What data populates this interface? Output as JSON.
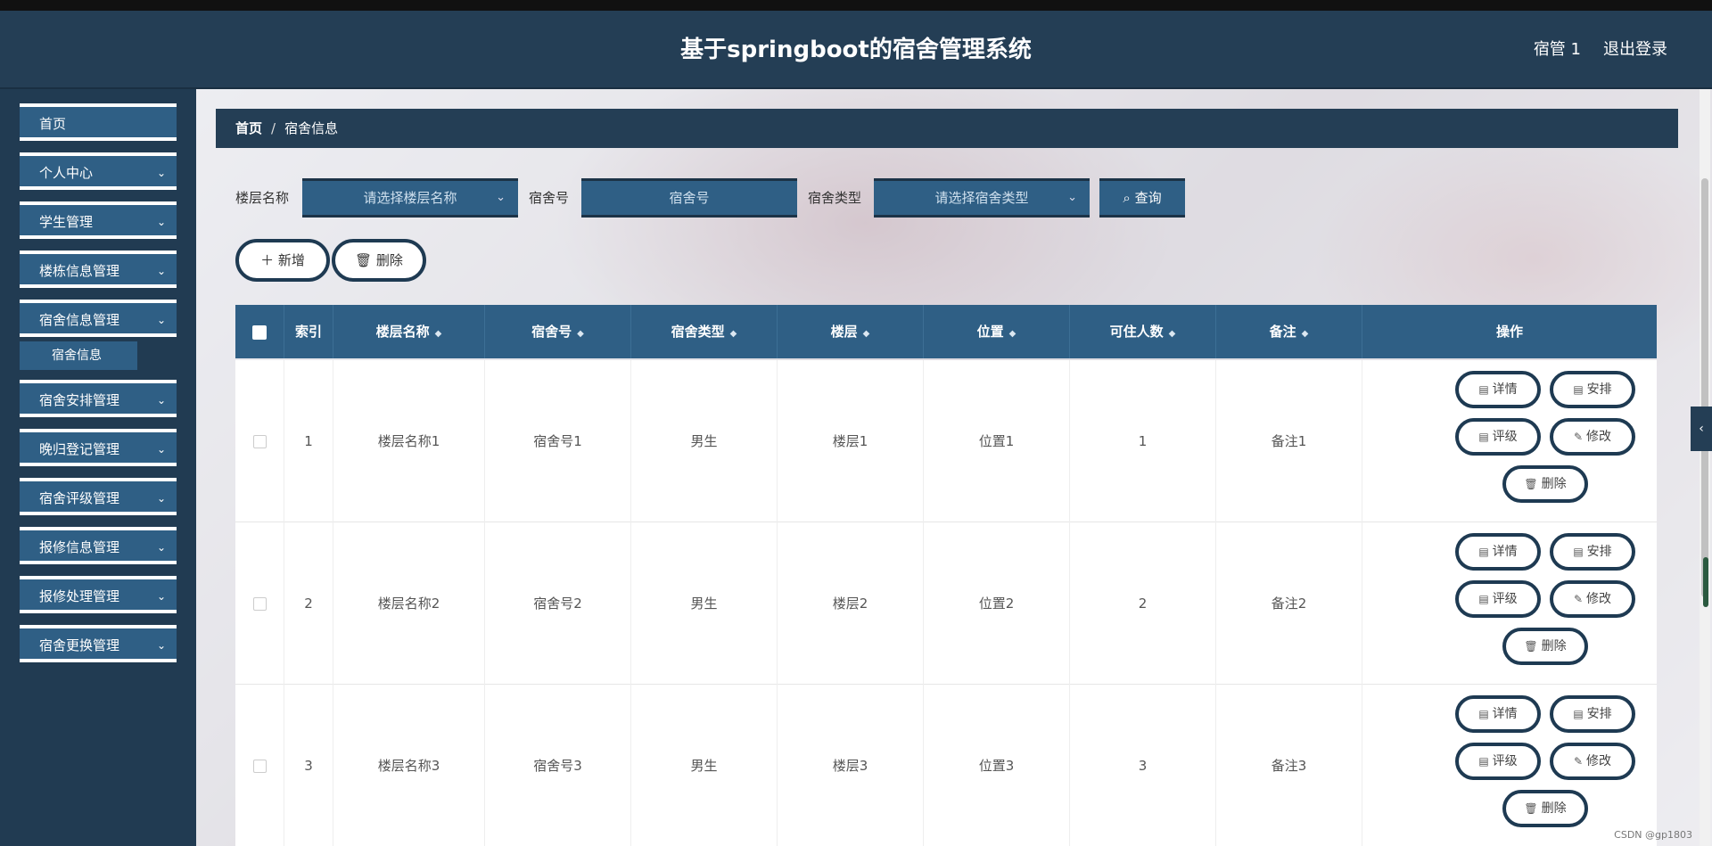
{
  "header": {
    "title": "基于springboot的宿舍管理系统",
    "user": "宿管 1",
    "logout": "退出登录"
  },
  "sidebar": {
    "items": [
      {
        "label": "首页",
        "chevron": ""
      },
      {
        "label": "个人中心",
        "chevron": "⌄"
      },
      {
        "label": "学生管理",
        "chevron": "⌄"
      },
      {
        "label": "楼栋信息管理",
        "chevron": "⌄"
      },
      {
        "label": "宿舍信息管理",
        "chevron": "⌄"
      },
      {
        "label": "宿舍安排管理",
        "chevron": "⌄"
      },
      {
        "label": "晚归登记管理",
        "chevron": "⌄"
      },
      {
        "label": "宿舍评级管理",
        "chevron": "⌄"
      },
      {
        "label": "报修信息管理",
        "chevron": "⌄"
      },
      {
        "label": "报修处理管理",
        "chevron": "⌄"
      },
      {
        "label": "宿舍更换管理",
        "chevron": "⌄"
      }
    ],
    "sub_item": "宿舍信息"
  },
  "breadcrumb": {
    "home": "首页",
    "sep": "/",
    "current": "宿舍信息"
  },
  "filters": {
    "floor_label": "楼层名称",
    "floor_placeholder": "请选择楼层名称",
    "room_label": "宿舍号",
    "room_placeholder": "宿舍号",
    "type_label": "宿舍类型",
    "type_placeholder": "请选择宿舍类型",
    "query": "查询"
  },
  "actions": {
    "add": "新增",
    "delete": "删除"
  },
  "table": {
    "headers": [
      "索引",
      "楼层名称",
      "宿舍号",
      "宿舍类型",
      "楼层",
      "位置",
      "可住人数",
      "备注",
      "操作"
    ],
    "rows": [
      {
        "index": "1",
        "floor_name": "楼层名称1",
        "room": "宿舍号1",
        "type": "男生",
        "floor": "楼层1",
        "location": "位置1",
        "capacity": "1",
        "note": "备注1"
      },
      {
        "index": "2",
        "floor_name": "楼层名称2",
        "room": "宿舍号2",
        "type": "男生",
        "floor": "楼层2",
        "location": "位置2",
        "capacity": "2",
        "note": "备注2"
      },
      {
        "index": "3",
        "floor_name": "楼层名称3",
        "room": "宿舍号3",
        "type": "男生",
        "floor": "楼层3",
        "location": "位置3",
        "capacity": "3",
        "note": "备注3"
      }
    ],
    "ops": {
      "detail": "详情",
      "arrange": "安排",
      "rate": "评级",
      "edit": "修改",
      "delete": "删除"
    }
  },
  "watermark": "CSDN @gp1803"
}
